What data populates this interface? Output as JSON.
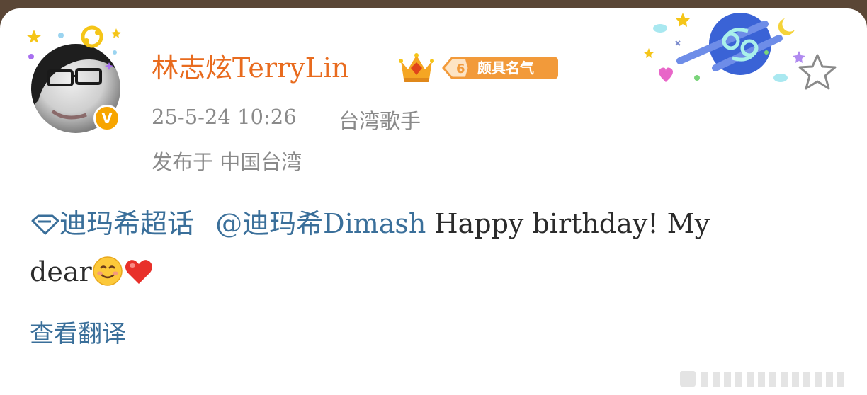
{
  "post": {
    "author_name": "林志炫TerryLin",
    "fame_badge_level": "6",
    "fame_badge_label": "颇具名气",
    "timestamp": "25-5-24 10:26",
    "source": "台湾歌手",
    "location": "发布于 中国台湾",
    "topic": "迪玛希超话",
    "mention": "@迪玛希Dimash",
    "text_line1": " Happy birthday! My",
    "text_line2": "dear",
    "translate_label": "查看翻译",
    "verified_badge": "V"
  },
  "icons": {
    "crown": "crown-icon",
    "topic": "diamond-topic-icon",
    "star": "star-outline-icon",
    "emoji_smile": "smiling-face-emoji",
    "emoji_heart": "red-heart-emoji",
    "constellation": "cancer-zodiac-icon"
  },
  "colors": {
    "author": "#e86b1e",
    "link": "#3a6f9a",
    "meta": "#8a8a8a",
    "badge_orange": "#f7a500"
  }
}
